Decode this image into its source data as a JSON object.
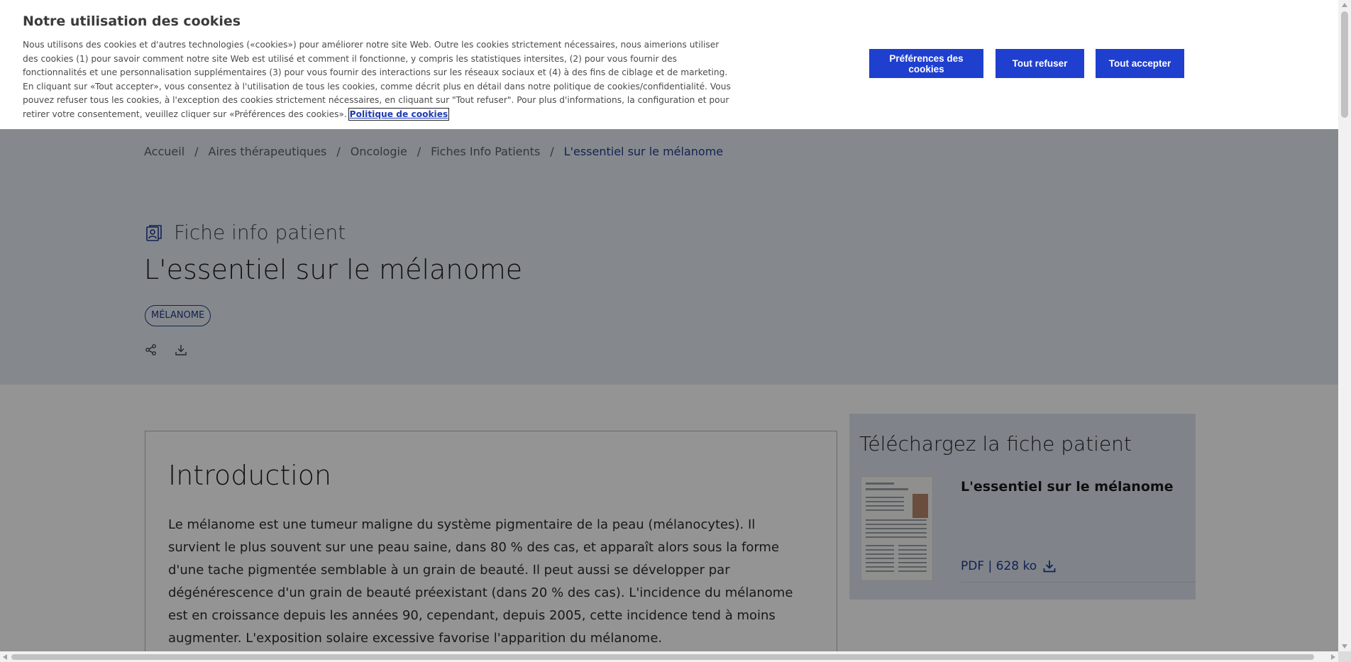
{
  "cookie_banner": {
    "title": "Notre utilisation des cookies",
    "body": "Nous utilisons des cookies et d'autres technologies («cookies») pour améliorer notre site Web. Outre les cookies strictement nécessaires, nous aimerions utiliser des cookies (1) pour savoir comment notre site Web est utilisé et comment il fonctionne, y compris les statistiques intersites, (2) pour vous fournir des fonctionnalités et une personnalisation supplémentaires (3) pour vous fournir des interactions sur les réseaux sociaux et (4) à des fins de ciblage et de marketing. En cliquant sur «Tout accepter», vous consentez à l'utilisation de tous les cookies, comme décrit plus en détail dans notre politique de cookies/confidentialité. Vous pouvez refuser tous les cookies, à l'exception des cookies strictement nécessaires, en cliquant sur \"Tout refuser\". Pour plus d'informations, la configuration et pour retirer votre consentement, veuillez cliquer sur «Préférences des cookies».",
    "policy_link": "Politique de cookies",
    "buttons": {
      "preferences": "Préférences des cookies",
      "refuse": "Tout refuser",
      "accept": "Tout accepter"
    },
    "button_color": "#1f3fcf"
  },
  "breadcrumb": {
    "items": [
      "Accueil",
      "Aires thérapeutiques",
      "Oncologie",
      "Fiches Info Patients",
      "L'essentiel sur le mélanome"
    ],
    "separator": "/"
  },
  "header": {
    "page_type": "Fiche info patient",
    "page_type_icon": "patient-sheet-icon",
    "title": "L'essentiel sur le mélanome",
    "tag": "MÉLANOME",
    "actions": [
      "share-icon",
      "download-icon"
    ]
  },
  "content": {
    "heading": "Introduction",
    "paragraph": "Le mélanome est une tumeur maligne du système pigmentaire de la peau (mélanocytes). Il survient le plus souvent sur une peau saine, dans 80 % des cas, et apparaît alors sous la forme d'une tache pigmentée semblable à un grain de beauté. Il peut aussi se développer par dégénérescence d'un grain de beauté préexistant (dans 20 % des cas). L'incidence du mélanome est en croissance depuis les années 90, cependant, depuis 2005, cette incidence tend à moins augmenter. L'exposition solaire excessive favorise l'apparition du mélanome."
  },
  "download_panel": {
    "heading": "Téléchargez la fiche patient",
    "file_name": "L'essentiel sur le mélanome",
    "file_meta": "PDF | 628 ko"
  },
  "colors": {
    "accent": "#1f3b8f",
    "hero_bg": "#e6ecf3",
    "panel_bg": "#dde4ee"
  }
}
